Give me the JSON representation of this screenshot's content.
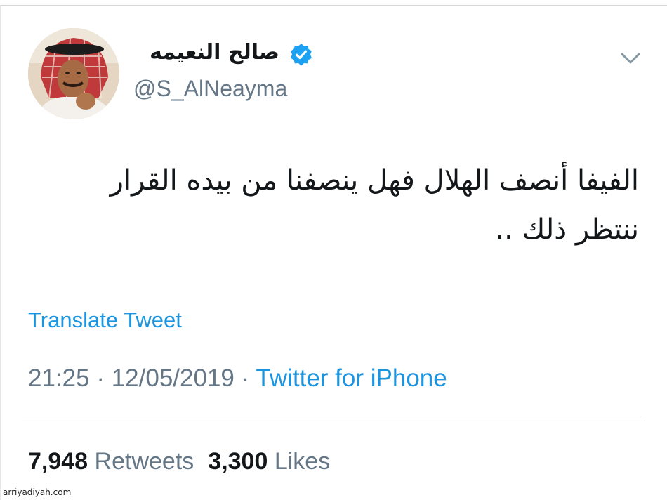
{
  "tweet": {
    "author": {
      "display_name": "صالح النعيمه",
      "handle": "@S_AlNeayma",
      "verified": true,
      "avatar_icon": "user-avatar-photo"
    },
    "menu_icon": "chevron-down-icon",
    "text_lines": [
      "الفيفا أنصف الهلال فهل ينصفنا من بيده القرار",
      "ننتظر ذلك .."
    ],
    "translate_label": "Translate Tweet",
    "time": "21:25",
    "separator": "·",
    "date": "12/05/2019",
    "source": "Twitter for iPhone",
    "stats": {
      "retweets_count": "7,948",
      "retweets_label": "Retweets",
      "likes_count": "3,300",
      "likes_label": "Likes"
    }
  },
  "watermark": "arriyadiyah.com",
  "colors": {
    "link": "#1b95e0",
    "secondary_text": "#657786",
    "primary_text": "#14171a",
    "verified": "#1da1f2"
  }
}
